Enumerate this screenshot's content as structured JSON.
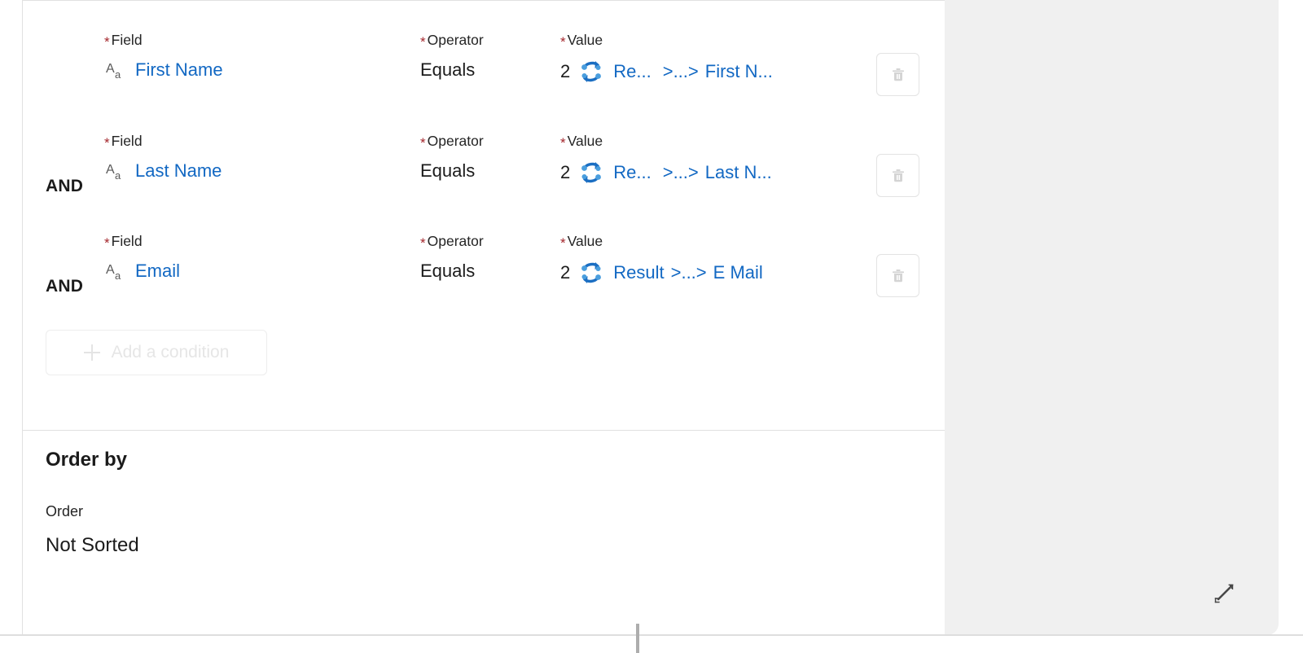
{
  "panel": {
    "conditions_section": {
      "column_headers": {
        "field": "Field",
        "operator": "Operator",
        "value": "Value"
      },
      "required_marker": "*",
      "rows": [
        {
          "conjunction": "",
          "field_icon": "text-field-icon",
          "field": "First Name",
          "operator": "Equals",
          "value_count": "2",
          "value_icon": "sync-arrows-icon",
          "value_source": "Re...",
          "value_separator": ">...>",
          "value_target": "First N...",
          "delete_icon": "trash-icon"
        },
        {
          "conjunction": "AND",
          "field_icon": "text-field-icon",
          "field": "Last Name",
          "operator": "Equals",
          "value_count": "2",
          "value_icon": "sync-arrows-icon",
          "value_source": "Re...",
          "value_separator": ">...>",
          "value_target": "Last N...",
          "delete_icon": "trash-icon"
        },
        {
          "conjunction": "AND",
          "field_icon": "text-field-icon",
          "field": "Email",
          "operator": "Equals",
          "value_count": "2",
          "value_icon": "sync-arrows-icon",
          "value_source": "Result",
          "value_separator": ">...>",
          "value_target": "E Mail",
          "delete_icon": "trash-icon"
        }
      ],
      "add_condition_label": "Add a condition",
      "add_condition_icon": "plus-icon"
    },
    "order_by_section": {
      "title": "Order by",
      "order_label": "Order",
      "order_value": "Not Sorted"
    },
    "expand_icon": "expand-diagonal-arrows-icon"
  },
  "colors": {
    "link_blue": "#1268c3",
    "required_red": "#a4262c",
    "text_primary": "#1b1b1b",
    "icon_gray": "#5a5a5a",
    "disabled_gray": "#e6e6e6",
    "panel_gray": "#f0f0f0",
    "border_gray": "#e1e1e1",
    "sync_blue_dark": "#1b6ec2",
    "sync_blue_light": "#4a9ede"
  }
}
